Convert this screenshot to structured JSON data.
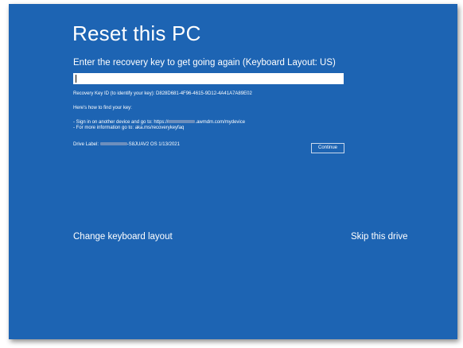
{
  "screen": {
    "title": "Reset this PC",
    "prompt": "Enter the recovery key to get going again (Keyboard Layout: US)",
    "recovery_key_input": {
      "value": ""
    },
    "recovery_key_id": "Recovery Key ID (to identify your key): D828D681-4F96-4615-9D12-4A41A7A89E02",
    "how_to_find": "Here's how to find your key:",
    "instruction_1_prefix": "- Sign in on another device and go to: https://",
    "instruction_1_suffix": ".awmdm.com/mydevice",
    "instruction_2": "- For more information go to: aka.ms/recoverykeyfaq",
    "drive_label_prefix": "Drive Label: ",
    "drive_label_suffix": "-S8JUAV2 OS 1/13/2021",
    "continue_label": "Continue",
    "change_keyboard_label": "Change keyboard layout",
    "skip_drive_label": "Skip this drive"
  },
  "colors": {
    "background": "#1d64b3",
    "text": "#ffffff",
    "input_bg": "#ffffff"
  }
}
